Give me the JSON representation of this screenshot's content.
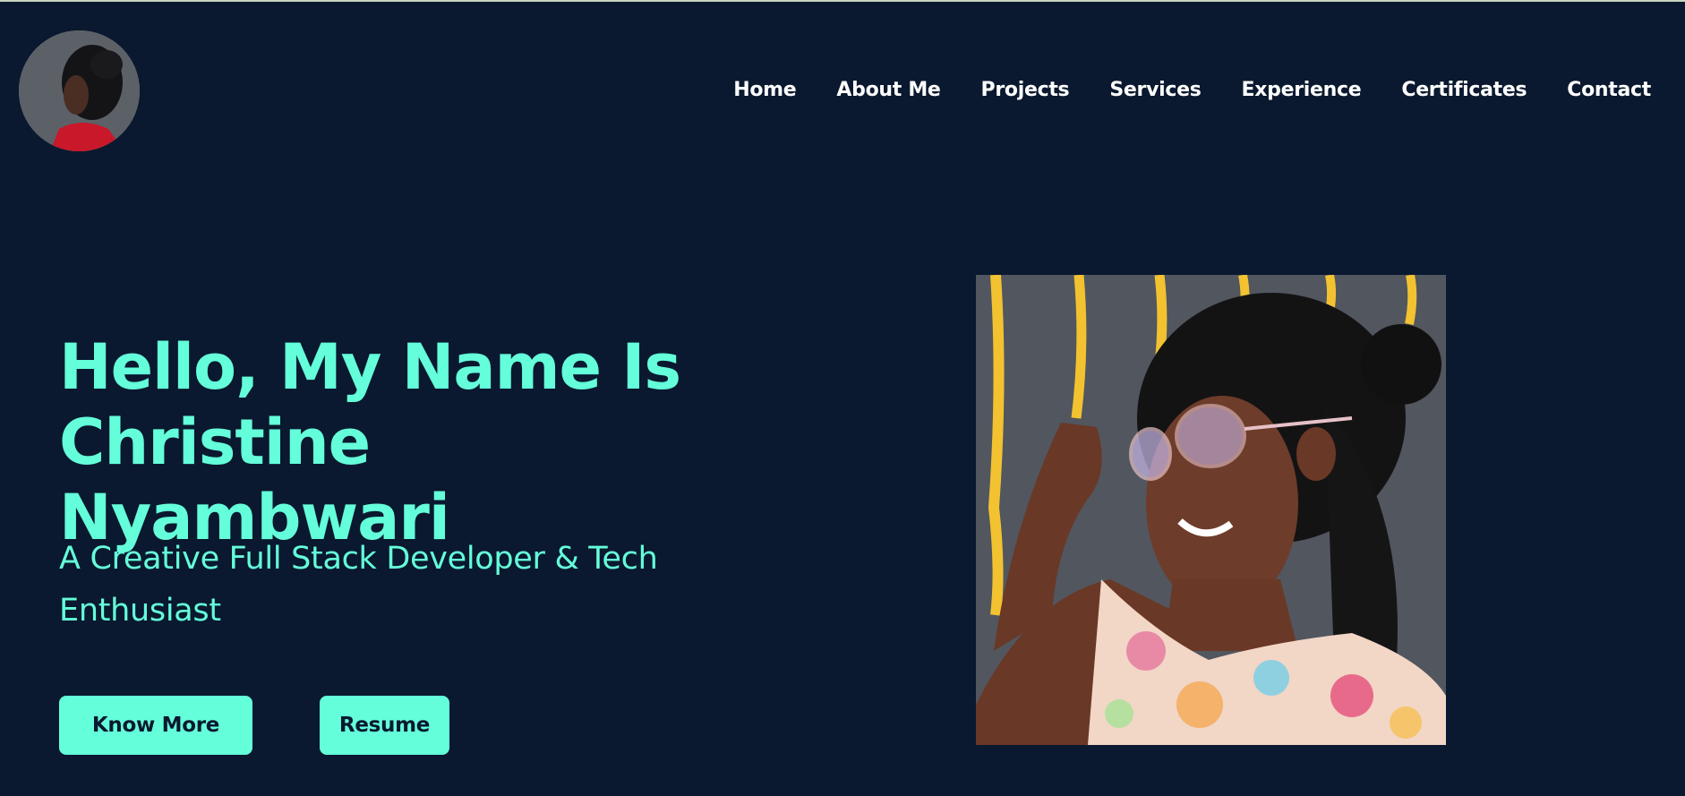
{
  "header": {
    "logo_icon": "profile-photo-avatar",
    "nav": [
      {
        "label": "Home"
      },
      {
        "label": "About Me"
      },
      {
        "label": "Projects"
      },
      {
        "label": "Services"
      },
      {
        "label": "Experience"
      },
      {
        "label": "Certificates"
      },
      {
        "label": "Contact"
      }
    ]
  },
  "hero": {
    "title_line1": "Hello, My Name Is",
    "title_line2": "Christine Nyambwari",
    "subtitle": "A Creative Full Stack Developer & Tech Enthusiast",
    "buttons": {
      "know_more": "Know More",
      "resume": "Resume"
    },
    "photo_icon": "portrait-photo"
  },
  "colors": {
    "background": "#0a192f",
    "accent": "#64ffda",
    "nav_text": "#ffffff"
  }
}
